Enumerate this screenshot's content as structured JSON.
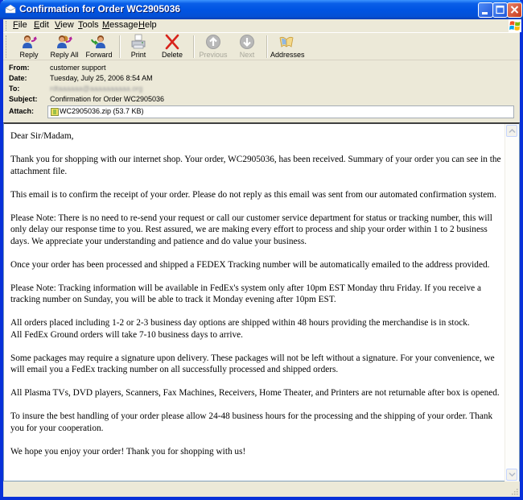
{
  "window": {
    "title": "Confirmation for Order WC2905036"
  },
  "menu": {
    "items": [
      {
        "label": "File",
        "accel": "F"
      },
      {
        "label": "Edit",
        "accel": "E"
      },
      {
        "label": "View",
        "accel": "V"
      },
      {
        "label": "Tools",
        "accel": "T"
      },
      {
        "label": "Message",
        "accel": "M"
      },
      {
        "label": "Help",
        "accel": "H"
      }
    ]
  },
  "toolbar": {
    "reply": "Reply",
    "reply_all": "Reply All",
    "forward": "Forward",
    "print": "Print",
    "delete": "Delete",
    "previous": "Previous",
    "next": "Next",
    "addresses": "Addresses"
  },
  "headers": {
    "from_label": "From:",
    "from": "customer support",
    "date_label": "Date:",
    "date": "Tuesday, July 25, 2006 8:54 AM",
    "to_label": "To:",
    "to": "rdtaaaaaa@aaaaaaaaaa.org",
    "subject_label": "Subject:",
    "subject": "Confirmation for Order WC2905036",
    "attach_label": "Attach:",
    "attachment": "WC2905036.zip (53.7 KB)"
  },
  "body": {
    "paragraphs": [
      "Dear Sir/Madam,",
      "Thank you for shopping with our internet shop. Your order, WC2905036, has been received. Summary of your order you can see in the attachment file.",
      "This email is to confirm the receipt of your order. Please do not reply as this email was sent from our automated confirmation system.",
      "Please Note: There is no need to re-send your request or call our customer service department for status or tracking number, this will only delay our response time to you. Rest assured, we are making every effort to process and ship your order within 1 to 2 business days. We appreciate your understanding and patience and do value your business.",
      "Once your order has been processed and shipped a FEDEX Tracking number will be automatically emailed to the address provided.",
      "Please Note: Tracking information will be available in FedEx's system only after 10pm EST Monday thru Friday. If you receive a tracking number on Sunday, you will be able to track it Monday evening after 10pm EST.",
      "All orders placed including 1-2 or 2-3 business day options are shipped within 48 hours providing the merchandise is in stock.",
      "All FedEx Ground orders will take 7-10 business days to arrive.",
      "Some packages may require a signature upon delivery. These packages will not be left without a signature. For your convenience, we will email you a FedEx tracking number on all successfully processed and shipped orders.",
      "All Plasma TVs, DVD players, Scanners, Fax Machines, Receivers, Home Theater, and Printers are not returnable after box is opened.",
      "To insure the best handling of your order please allow 24-48 business hours for the processing and the shipping of your order. Thank you for your cooperation.",
      "We hope you enjoy your order!  Thank you for shopping with us!"
    ]
  }
}
